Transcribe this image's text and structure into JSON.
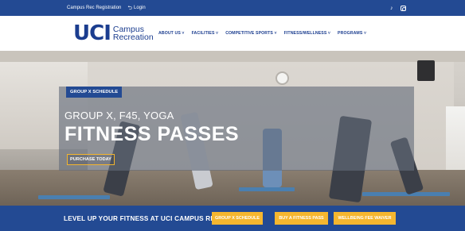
{
  "topbar": {
    "registration_link": "Campus Rec Registration",
    "login_link": "Login",
    "login_icon": "login-arrow-icon",
    "social_icons": [
      "tiktok-icon",
      "instagram-icon"
    ]
  },
  "logo": {
    "mark": "UCI",
    "line1": "Campus",
    "line2": "Recreation"
  },
  "nav": {
    "items": [
      "ABOUT US ˅",
      "FACILITIES ˅",
      "COMPETITIVE SPORTS ˅",
      "FITNESS/WELLNESS ˅",
      "PROGRAMS ˅"
    ]
  },
  "hero": {
    "tag": "GROUP X SCHEDULE",
    "subtitle": "GROUP X, F45, YOGA",
    "title": "FITNESS PASSES",
    "cta": "PURCHASE TODAY"
  },
  "band": {
    "text": "LEVEL UP YOUR FITNESS AT UCI CAMPUS REC",
    "buttons": [
      "GROUP X SCHEDULE",
      "BUY A FITNESS PASS",
      "WELLBEING FEE WAIVER"
    ]
  },
  "colors": {
    "brand_blue": "#234a93",
    "accent_gold": "#f5b62f",
    "white": "#ffffff"
  }
}
